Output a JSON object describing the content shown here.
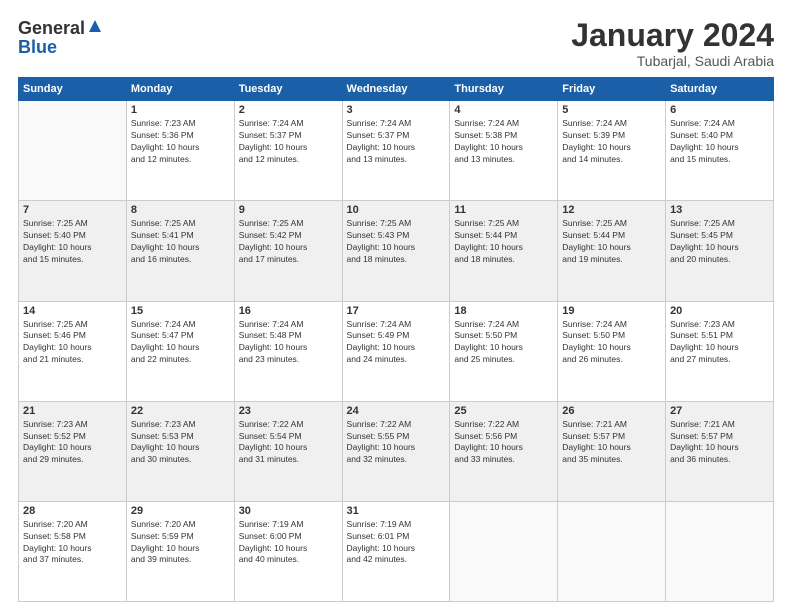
{
  "logo": {
    "general": "General",
    "blue": "Blue"
  },
  "title": {
    "month": "January 2024",
    "location": "Tubarjal, Saudi Arabia"
  },
  "days_header": [
    "Sunday",
    "Monday",
    "Tuesday",
    "Wednesday",
    "Thursday",
    "Friday",
    "Saturday"
  ],
  "weeks": [
    [
      {
        "num": "",
        "info": ""
      },
      {
        "num": "1",
        "info": "Sunrise: 7:23 AM\nSunset: 5:36 PM\nDaylight: 10 hours\nand 12 minutes."
      },
      {
        "num": "2",
        "info": "Sunrise: 7:24 AM\nSunset: 5:37 PM\nDaylight: 10 hours\nand 12 minutes."
      },
      {
        "num": "3",
        "info": "Sunrise: 7:24 AM\nSunset: 5:37 PM\nDaylight: 10 hours\nand 13 minutes."
      },
      {
        "num": "4",
        "info": "Sunrise: 7:24 AM\nSunset: 5:38 PM\nDaylight: 10 hours\nand 13 minutes."
      },
      {
        "num": "5",
        "info": "Sunrise: 7:24 AM\nSunset: 5:39 PM\nDaylight: 10 hours\nand 14 minutes."
      },
      {
        "num": "6",
        "info": "Sunrise: 7:24 AM\nSunset: 5:40 PM\nDaylight: 10 hours\nand 15 minutes."
      }
    ],
    [
      {
        "num": "7",
        "info": "Sunrise: 7:25 AM\nSunset: 5:40 PM\nDaylight: 10 hours\nand 15 minutes."
      },
      {
        "num": "8",
        "info": "Sunrise: 7:25 AM\nSunset: 5:41 PM\nDaylight: 10 hours\nand 16 minutes."
      },
      {
        "num": "9",
        "info": "Sunrise: 7:25 AM\nSunset: 5:42 PM\nDaylight: 10 hours\nand 17 minutes."
      },
      {
        "num": "10",
        "info": "Sunrise: 7:25 AM\nSunset: 5:43 PM\nDaylight: 10 hours\nand 18 minutes."
      },
      {
        "num": "11",
        "info": "Sunrise: 7:25 AM\nSunset: 5:44 PM\nDaylight: 10 hours\nand 18 minutes."
      },
      {
        "num": "12",
        "info": "Sunrise: 7:25 AM\nSunset: 5:44 PM\nDaylight: 10 hours\nand 19 minutes."
      },
      {
        "num": "13",
        "info": "Sunrise: 7:25 AM\nSunset: 5:45 PM\nDaylight: 10 hours\nand 20 minutes."
      }
    ],
    [
      {
        "num": "14",
        "info": "Sunrise: 7:25 AM\nSunset: 5:46 PM\nDaylight: 10 hours\nand 21 minutes."
      },
      {
        "num": "15",
        "info": "Sunrise: 7:24 AM\nSunset: 5:47 PM\nDaylight: 10 hours\nand 22 minutes."
      },
      {
        "num": "16",
        "info": "Sunrise: 7:24 AM\nSunset: 5:48 PM\nDaylight: 10 hours\nand 23 minutes."
      },
      {
        "num": "17",
        "info": "Sunrise: 7:24 AM\nSunset: 5:49 PM\nDaylight: 10 hours\nand 24 minutes."
      },
      {
        "num": "18",
        "info": "Sunrise: 7:24 AM\nSunset: 5:50 PM\nDaylight: 10 hours\nand 25 minutes."
      },
      {
        "num": "19",
        "info": "Sunrise: 7:24 AM\nSunset: 5:50 PM\nDaylight: 10 hours\nand 26 minutes."
      },
      {
        "num": "20",
        "info": "Sunrise: 7:23 AM\nSunset: 5:51 PM\nDaylight: 10 hours\nand 27 minutes."
      }
    ],
    [
      {
        "num": "21",
        "info": "Sunrise: 7:23 AM\nSunset: 5:52 PM\nDaylight: 10 hours\nand 29 minutes."
      },
      {
        "num": "22",
        "info": "Sunrise: 7:23 AM\nSunset: 5:53 PM\nDaylight: 10 hours\nand 30 minutes."
      },
      {
        "num": "23",
        "info": "Sunrise: 7:22 AM\nSunset: 5:54 PM\nDaylight: 10 hours\nand 31 minutes."
      },
      {
        "num": "24",
        "info": "Sunrise: 7:22 AM\nSunset: 5:55 PM\nDaylight: 10 hours\nand 32 minutes."
      },
      {
        "num": "25",
        "info": "Sunrise: 7:22 AM\nSunset: 5:56 PM\nDaylight: 10 hours\nand 33 minutes."
      },
      {
        "num": "26",
        "info": "Sunrise: 7:21 AM\nSunset: 5:57 PM\nDaylight: 10 hours\nand 35 minutes."
      },
      {
        "num": "27",
        "info": "Sunrise: 7:21 AM\nSunset: 5:57 PM\nDaylight: 10 hours\nand 36 minutes."
      }
    ],
    [
      {
        "num": "28",
        "info": "Sunrise: 7:20 AM\nSunset: 5:58 PM\nDaylight: 10 hours\nand 37 minutes."
      },
      {
        "num": "29",
        "info": "Sunrise: 7:20 AM\nSunset: 5:59 PM\nDaylight: 10 hours\nand 39 minutes."
      },
      {
        "num": "30",
        "info": "Sunrise: 7:19 AM\nSunset: 6:00 PM\nDaylight: 10 hours\nand 40 minutes."
      },
      {
        "num": "31",
        "info": "Sunrise: 7:19 AM\nSunset: 6:01 PM\nDaylight: 10 hours\nand 42 minutes."
      },
      {
        "num": "",
        "info": ""
      },
      {
        "num": "",
        "info": ""
      },
      {
        "num": "",
        "info": ""
      }
    ]
  ]
}
